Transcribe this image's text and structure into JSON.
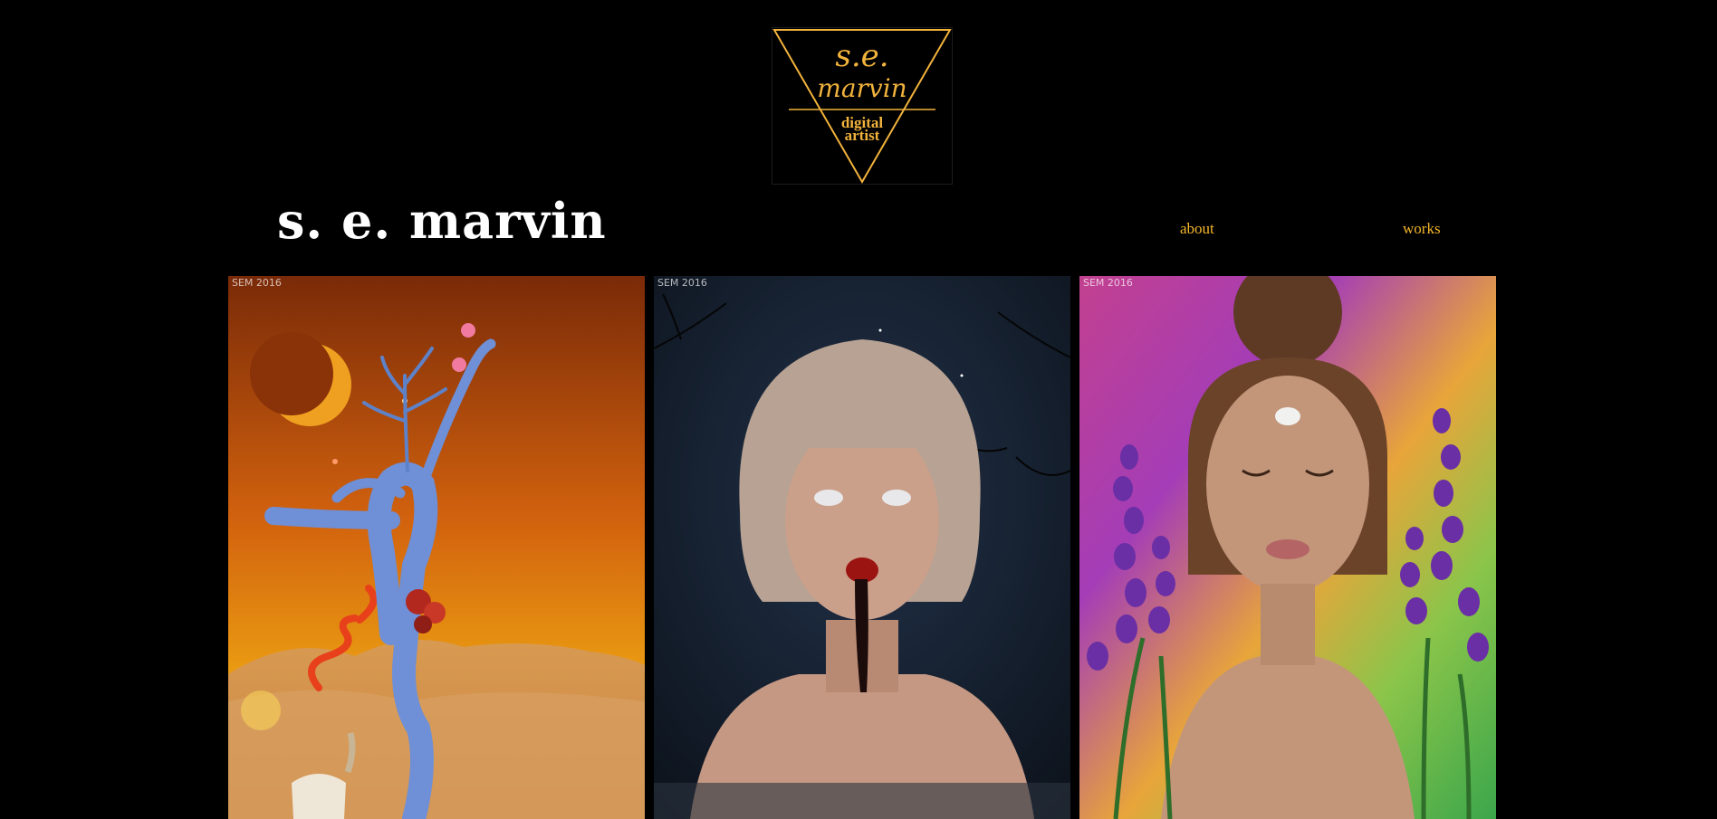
{
  "logo": {
    "line1": "s.e.",
    "line2": "marvin",
    "line3": "digital",
    "line4": "artist",
    "accent": "#f2b33c"
  },
  "site_title": "s. e. marvin",
  "nav": {
    "about": "about",
    "works": "works",
    "link_color": "#f4b52b"
  },
  "gallery": [
    {
      "signature": "SEM 2016"
    },
    {
      "signature": "SEM 2016"
    },
    {
      "signature": "SEM 2016"
    }
  ]
}
